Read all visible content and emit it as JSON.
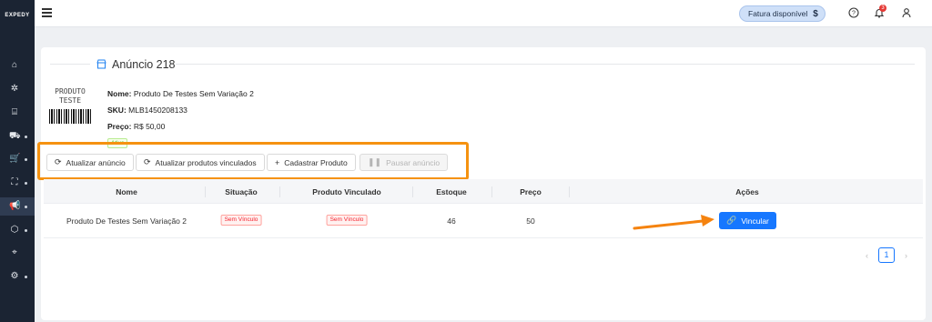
{
  "app": {
    "logo": "EXPEDY"
  },
  "sidebar": {
    "items": [
      {
        "icon": "home-icon",
        "glyph": "⌂"
      },
      {
        "icon": "integrations-icon",
        "glyph": "✲"
      },
      {
        "icon": "store-icon",
        "glyph": "⌸"
      },
      {
        "icon": "truck-icon",
        "glyph": "⛟"
      },
      {
        "icon": "cart-icon",
        "glyph": "🛒"
      },
      {
        "icon": "bag-icon",
        "glyph": "⛶"
      },
      {
        "icon": "megaphone-icon",
        "glyph": "📢"
      },
      {
        "icon": "box-icon",
        "glyph": "⬡"
      },
      {
        "icon": "scan-icon",
        "glyph": "⌖"
      },
      {
        "icon": "gear-icon",
        "glyph": "⚙"
      }
    ]
  },
  "topbar": {
    "invoice_label": "Fatura disponível",
    "invoice_icon": "$",
    "notification_count": "3"
  },
  "page": {
    "title": "Anúncio 218"
  },
  "product": {
    "image_line1": "PRODUTO",
    "image_line2": "TESTE",
    "name_label": "Nome:",
    "name": "Produto De Testes Sem Variação 2",
    "sku_label": "SKU:",
    "sku": "MLB1450208133",
    "price_label": "Preço:",
    "price": "R$ 50,00",
    "status": "Ativo"
  },
  "actions": {
    "update_listing": "Atualizar anúncio",
    "update_linked": "Atualizar produtos vinculados",
    "register_product": "Cadastrar Produto",
    "pause_listing": "Pausar anúncio"
  },
  "table": {
    "headers": [
      "Nome",
      "Situação",
      "Produto Vinculado",
      "Estoque",
      "Preço",
      "Ações"
    ],
    "rows": [
      {
        "name": "Produto De Testes Sem Variação 2",
        "situation": "Sem Vínculo",
        "linked_product": "Sem Vínculo",
        "stock": "46",
        "price": "50",
        "action": "Vincular"
      }
    ]
  },
  "pagination": {
    "current": "1",
    "prev": "‹",
    "next": "›"
  },
  "colors": {
    "accent": "#1677ff",
    "highlight": "#f59210",
    "sidebar": "#1b2433"
  }
}
